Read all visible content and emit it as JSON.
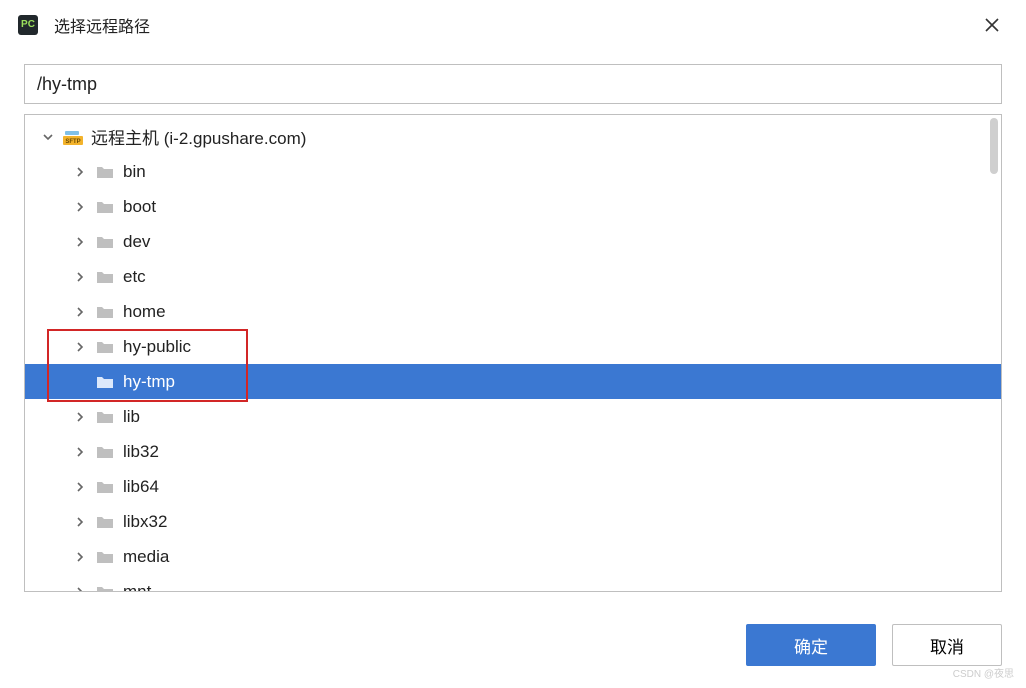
{
  "window": {
    "title": "选择远程路径",
    "app_icon_text": "PC"
  },
  "path_input": {
    "value": "/hy-tmp"
  },
  "tree": {
    "root_label": "远程主机 (i-2.gpushare.com)",
    "items": [
      {
        "label": "bin",
        "expandable": true,
        "selected": false
      },
      {
        "label": "boot",
        "expandable": true,
        "selected": false
      },
      {
        "label": "dev",
        "expandable": true,
        "selected": false
      },
      {
        "label": "etc",
        "expandable": true,
        "selected": false
      },
      {
        "label": "home",
        "expandable": true,
        "selected": false
      },
      {
        "label": "hy-public",
        "expandable": true,
        "selected": false
      },
      {
        "label": "hy-tmp",
        "expandable": false,
        "selected": true
      },
      {
        "label": "lib",
        "expandable": true,
        "selected": false
      },
      {
        "label": "lib32",
        "expandable": true,
        "selected": false
      },
      {
        "label": "lib64",
        "expandable": true,
        "selected": false
      },
      {
        "label": "libx32",
        "expandable": true,
        "selected": false
      },
      {
        "label": "media",
        "expandable": true,
        "selected": false
      },
      {
        "label": "mnt",
        "expandable": true,
        "selected": false
      }
    ]
  },
  "buttons": {
    "ok": "确定",
    "cancel": "取消"
  },
  "watermark": "CSDN @夜思"
}
